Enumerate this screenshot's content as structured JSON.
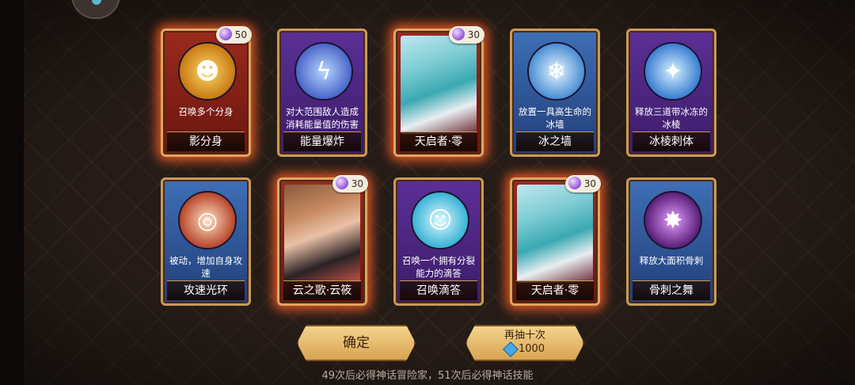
{
  "cards": [
    {
      "name": "影分身",
      "desc": "召唤多个分身",
      "cost": "50",
      "icon": "shadow-clone-icon"
    },
    {
      "name": "能量爆炸",
      "desc": "对大范围敌人造成消耗能量值的伤害",
      "icon": "lightning-icon"
    },
    {
      "name": "天启者·零",
      "cost": "30",
      "icon": "character-portrait"
    },
    {
      "name": "冰之墙",
      "desc": "放置一具高生命的冰墙",
      "icon": "ice-wall-icon"
    },
    {
      "name": "冰棱刺体",
      "desc": "释放三道带冰冻的冰棱",
      "icon": "ice-shard-icon"
    },
    {
      "name": "攻速光环",
      "desc": "被动，增加自身攻速",
      "icon": "halo-icon"
    },
    {
      "name": "云之歌·云筱",
      "cost": "30",
      "icon": "character-portrait"
    },
    {
      "name": "召唤滴答",
      "desc": "召唤一个拥有分裂能力的滴答",
      "icon": "slime-icon"
    },
    {
      "name": "天启者·零",
      "cost": "30",
      "icon": "character-portrait"
    },
    {
      "name": "骨刺之舞",
      "desc": "释放大面积骨刺",
      "icon": "bone-spike-icon"
    }
  ],
  "buttons": {
    "confirm": "确定",
    "redraw": "再抽十次",
    "redraw_cost": "1000"
  },
  "footer": "49次后必得神话冒险家，51次后必得神话技能",
  "colors": {
    "purple": "#5c2f96",
    "blue": "#3e6fb6",
    "red": "#9a2a1c",
    "gold": "#c99a57",
    "glow": "#ff6028"
  }
}
